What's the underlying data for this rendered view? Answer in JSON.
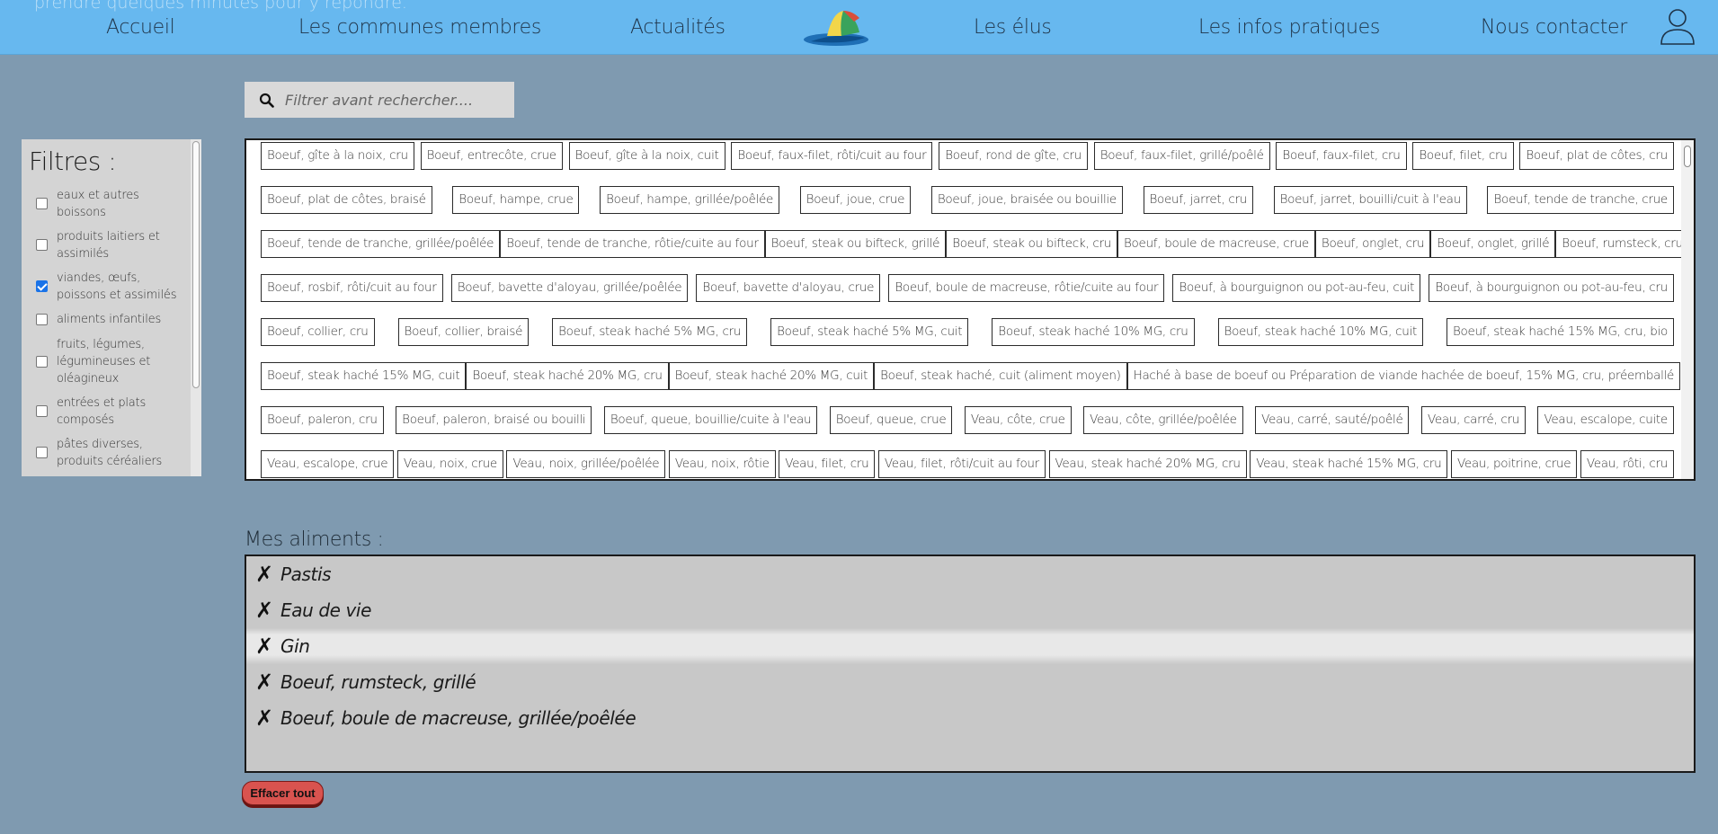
{
  "header": {
    "ghost_text": "prendre quelques minutes pour y répondre.",
    "nav": [
      {
        "label": "Accueil"
      },
      {
        "label": "Les communes membres"
      },
      {
        "label": "Actualités"
      },
      {
        "label": "Les élus"
      },
      {
        "label": "Les infos pratiques"
      },
      {
        "label": "Nous contacter"
      }
    ],
    "logo_icon": "lighthouse-logo-icon",
    "user_icon": "user-icon",
    "bar_color": "#67b8ef"
  },
  "search": {
    "placeholder": "Filtrer avant rechercher....",
    "value": "",
    "icon": "search-icon"
  },
  "filters": {
    "title": "Filtres :",
    "items": [
      {
        "label": "eaux et autres boissons",
        "checked": false
      },
      {
        "label": "produits laitiers et assimilés",
        "checked": false
      },
      {
        "label": "viandes, œufs, poissons et assimilés",
        "checked": true
      },
      {
        "label": "aliments infantiles",
        "checked": false
      },
      {
        "label": "fruits, légumes, légumineuses et oléagineux",
        "checked": false
      },
      {
        "label": "entrées et plats composés",
        "checked": false
      },
      {
        "label": "pâtes diverses, produits céréaliers",
        "checked": false
      }
    ]
  },
  "foods": {
    "rows": [
      [
        "Boeuf, gîte à la noix, cru",
        "Boeuf, entrecôte, crue",
        "Boeuf, gîte à la noix, cuit",
        "Boeuf, faux-filet, rôti/cuit au four",
        "Boeuf, rond de gîte, cru",
        "Boeuf, faux-filet, grillé/poêlé",
        "Boeuf, faux-filet, cru",
        "Boeuf, filet, cru",
        "Boeuf, plat de côtes, cru"
      ],
      [
        "Boeuf, plat de côtes, braisé",
        "Boeuf, hampe, crue",
        "Boeuf, hampe, grillée/poêlée",
        "Boeuf, joue, crue",
        "Boeuf, joue, braisée ou bouillie",
        "Boeuf, jarret, cru",
        "Boeuf, jarret, bouilli/cuit à l'eau",
        "Boeuf, tende de tranche, crue"
      ],
      [
        "Boeuf, tende de tranche, grillée/poêlée",
        "Boeuf, tende de tranche, rôtie/cuite au four",
        "Boeuf, steak ou bifteck, grillé",
        "Boeuf, steak ou bifteck, cru",
        "Boeuf, boule de macreuse, crue",
        "Boeuf, onglet, cru",
        "Boeuf, onglet, grillé",
        "Boeuf, rumsteck, cru"
      ],
      [
        "Boeuf, rosbif, rôti/cuit au four",
        "Boeuf, bavette d'aloyau, grillée/poêlée",
        "Boeuf, bavette d'aloyau, crue",
        "Boeuf, boule de macreuse, rôtie/cuite au four",
        "Boeuf, à bourguignon ou pot-au-feu, cuit",
        "Boeuf, à bourguignon ou pot-au-feu, cru"
      ],
      [
        "Boeuf, collier, cru",
        "Boeuf, collier, braisé",
        "Boeuf, steak haché 5% MG, cru",
        "Boeuf, steak haché 5% MG, cuit",
        "Boeuf, steak haché 10% MG, cru",
        "Boeuf, steak haché 10% MG, cuit",
        "Boeuf, steak haché 15% MG, cru, bio"
      ],
      [
        "Boeuf, steak haché 15% MG, cuit",
        "Boeuf, steak haché 20% MG, cru",
        "Boeuf, steak haché 20% MG, cuit",
        "Boeuf, steak haché, cuit (aliment moyen)",
        "Haché à base de boeuf ou Préparation de viande hachée de boeuf, 15% MG, cru, préemballé"
      ],
      [
        "Boeuf, paleron, cru",
        "Boeuf, paleron, braisé ou bouilli",
        "Boeuf, queue, bouillie/cuite à l'eau",
        "Boeuf, queue, crue",
        "Veau, côte, crue",
        "Veau, côte, grillée/poêlée",
        "Veau, carré, sauté/poêlé",
        "Veau, carré, cru",
        "Veau, escalope, cuite"
      ],
      [
        "Veau, escalope, crue",
        "Veau, noix, crue",
        "Veau, noix, grillée/poêlée",
        "Veau, noix, rôtie",
        "Veau, filet, cru",
        "Veau, filet, rôti/cuit au four",
        "Veau, steak haché 20% MG, cru",
        "Veau, steak haché 15% MG, cru",
        "Veau, poitrine, crue",
        "Veau, rôti, cru"
      ]
    ]
  },
  "mes_aliments": {
    "title": "Mes aliments :",
    "remove_icon": "✗",
    "items": [
      {
        "label": "Pastis",
        "highlighted": false
      },
      {
        "label": "Eau de vie",
        "highlighted": false
      },
      {
        "label": "Gin",
        "highlighted": true
      },
      {
        "label": "Boeuf, rumsteck, grillé",
        "highlighted": false
      },
      {
        "label": "Boeuf, boule de macreuse, grillée/poêlée",
        "highlighted": false
      }
    ]
  },
  "actions": {
    "clear_label": "Effacer tout",
    "clear_color": "#d9534f"
  }
}
